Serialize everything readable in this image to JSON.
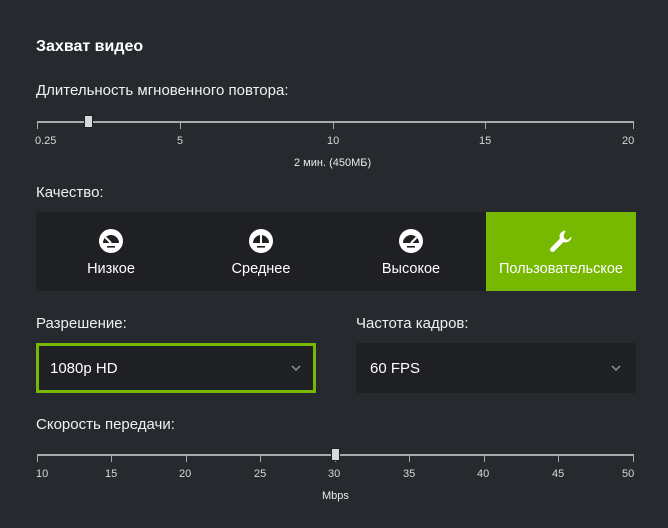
{
  "section_title": "Захват видео",
  "replay": {
    "label": "Длительность мгновенного повтора:",
    "value_caption": "2 мин. (450МБ)",
    "ticks": [
      "0.25",
      "5",
      "10",
      "15",
      "20"
    ],
    "min": 0.25,
    "max": 20,
    "value": 2
  },
  "quality": {
    "label": "Качество:",
    "options": [
      {
        "label": "Низкое",
        "icon": "gauge-low-icon"
      },
      {
        "label": "Среднее",
        "icon": "gauge-medium-icon"
      },
      {
        "label": "Высокое",
        "icon": "gauge-high-icon"
      },
      {
        "label": "Пользовательское",
        "icon": "wrench-icon"
      }
    ],
    "selected": "Пользовательское"
  },
  "resolution": {
    "label": "Разрешение:",
    "value": "1080p HD"
  },
  "framerate": {
    "label": "Частота кадров:",
    "value": "60 FPS"
  },
  "bitrate": {
    "label": "Скорость передачи:",
    "unit": "Mbps",
    "ticks": [
      "10",
      "15",
      "20",
      "25",
      "30",
      "35",
      "40",
      "45",
      "50"
    ],
    "min": 10,
    "max": 50,
    "value": 30
  },
  "colors": {
    "background": "#262a2e",
    "panel": "#1f2023",
    "accent": "#76b900",
    "track": "#a8abae"
  }
}
